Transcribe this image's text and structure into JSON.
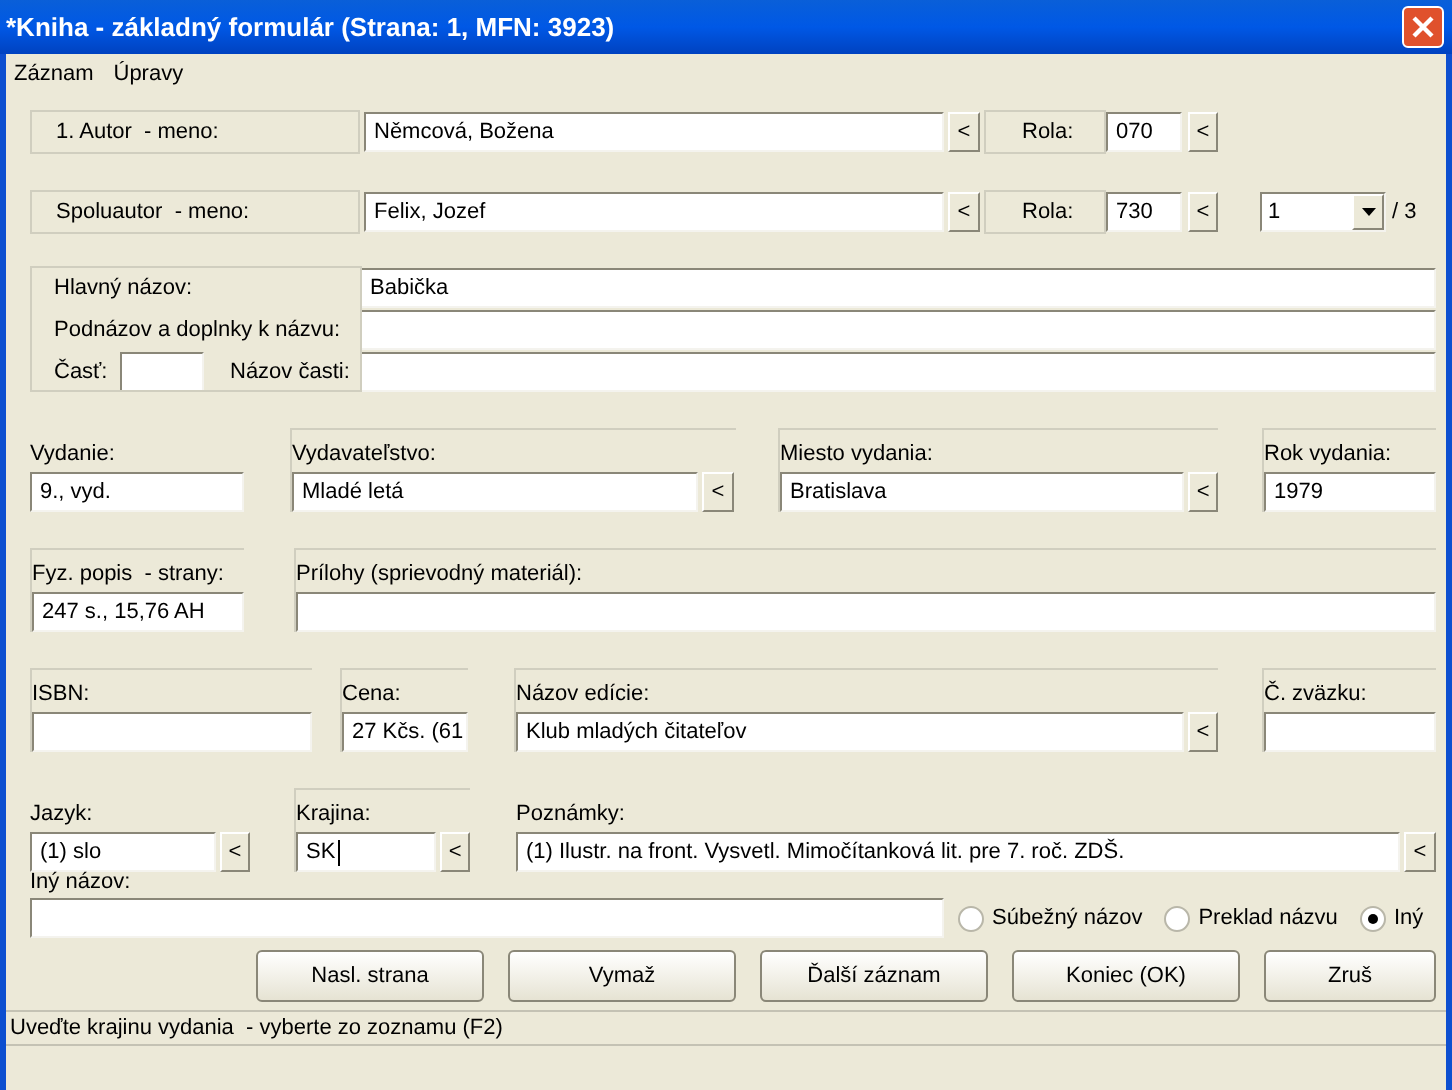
{
  "window": {
    "title": "*Kniha - základný formulár (Strana: 1, MFN: 3923)"
  },
  "menu": [
    {
      "label": "Záznam"
    },
    {
      "label": "Úpravy"
    }
  ],
  "author": {
    "label": "1. Autor  - meno:",
    "value": "Němcová, Božena",
    "picker": "<",
    "role_label": "Rola:",
    "role": "070",
    "role_picker": "<"
  },
  "coauthor": {
    "label": "Spoluautor  - meno:",
    "value": "Felix, Jozef",
    "picker": "<",
    "role_label": "Rola:",
    "role": "730",
    "role_picker": "<",
    "index": "1",
    "count": "/ 3"
  },
  "titles": {
    "main_label": "Hlavný názov:",
    "main": "Babička",
    "subtitle_label": "Podnázov a doplnky k názvu:",
    "part_label": "Časť:",
    "part_name_label": "Názov časti:"
  },
  "edition": {
    "label": "Vydanie:",
    "value": "9., vyd."
  },
  "publisher": {
    "label": "Vydavateľstvo:",
    "value": "Mladé letá",
    "picker": "<"
  },
  "place": {
    "label": "Miesto vydania:",
    "value": "Bratislava",
    "picker": "<"
  },
  "year": {
    "label": "Rok vydania:",
    "value": "1979"
  },
  "pages": {
    "label": "Fyz. popis  - strany:",
    "value": "247 s., 15,76 AH"
  },
  "attachments": {
    "label": "Prílohy (sprievodný materiál):"
  },
  "isbn": {
    "label": "ISBN:"
  },
  "price": {
    "label": "Cena:",
    "value": "27 Kčs. (61"
  },
  "series": {
    "label": "Názov edície:",
    "value": "Klub mladých čitateľov",
    "picker": "<"
  },
  "volume": {
    "label": "Č. zväzku:"
  },
  "language": {
    "label": "Jazyk:",
    "value": "(1) slo",
    "picker": "<"
  },
  "country": {
    "label": "Krajina:",
    "value": "SK",
    "picker": "<",
    "focused": true
  },
  "notes": {
    "label": "Poznámky:",
    "value": "(1) Ilustr. na front. Vysvetl. Mimočítanková lit. pre 7. roč. ZDŠ.",
    "picker": "<"
  },
  "other_title": {
    "label": "Iný názov:"
  },
  "title_types": [
    {
      "label": "Súbežný názov",
      "selected": false
    },
    {
      "label": "Preklad názvu",
      "selected": false
    },
    {
      "label": "Iný",
      "selected": true
    }
  ],
  "buttons": [
    {
      "label": "Nasl. strana"
    },
    {
      "label": "Vymaž"
    },
    {
      "label": "Ďalší záznam"
    },
    {
      "label": "Koniec (OK)"
    },
    {
      "label": "Zruš"
    }
  ],
  "status_bar": {
    "text": "Uveďte krajinu vydania  - vyberte zo zoznamu (F2)"
  }
}
